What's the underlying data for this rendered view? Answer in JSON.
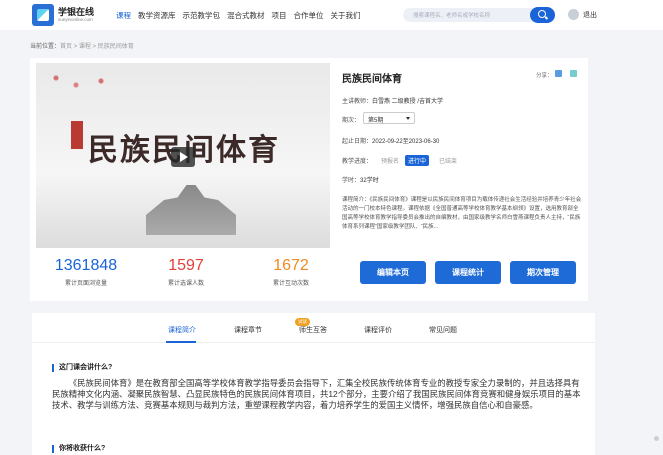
{
  "header": {
    "brand_name": "学银在线",
    "brand_sub": "xueyinonline.com",
    "nav": [
      "课程",
      "教学资源库",
      "示范教学包",
      "混合式教材",
      "项目",
      "合作单位",
      "关于我们"
    ],
    "search_placeholder": "搜索课程名、老师名或学校名称",
    "logout": "退出"
  },
  "breadcrumb": {
    "prefix": "当前位置：",
    "items": [
      "首页",
      "课程",
      "民族民间体育"
    ],
    "separator": " > "
  },
  "course": {
    "title": "民族民间体育",
    "cover_art_text": "民族民间体育",
    "share_label": "分享：",
    "teacher_label": "主讲教师：",
    "teacher_value": "白雪燕 二级教授 /吉首大学",
    "period_label": "期次：",
    "period_value": "第5期",
    "dates_label": "起止日期：",
    "dates_value": "2022-09-22至2023-06-30",
    "progress_label": "教学进度：",
    "progress_states": [
      "预报名",
      "进行中",
      "已结束"
    ],
    "progress_active_index": 1,
    "hours_label": "学时：",
    "hours_value": "32学时",
    "intro_label": "课程简介：",
    "intro_text": "《民族民间体育》课程是以民族民间体育项目为载体传递社会生活经验并培养青少年社会活动的一门校本特色课程。课程依据《全国普通高等学校体育教学基本纲领》设置，选用教育部全国高等学校体育教学指导委员会推出的自编教材，由国家级教学名师白雪燕课程负责人主持，“民族体育系列课程”国家级教学团队、“民族..."
  },
  "stats": [
    {
      "value": "1361848",
      "label": "累计页面浏览量",
      "color": "#1a64d8"
    },
    {
      "value": "1597",
      "label": "累计选课人数",
      "color": "#e0413a"
    },
    {
      "value": "1672",
      "label": "累计互动次数",
      "color": "#f08a24"
    }
  ],
  "actions": [
    "编辑本页",
    "课程统计",
    "期次管理"
  ],
  "tabs": {
    "items": [
      "课程简介",
      "课程章节",
      "师生互答",
      "课程评价",
      "常见问题"
    ],
    "active_index": 0,
    "badge": "试读"
  },
  "content": {
    "q1_title": "这门课会讲什么?",
    "q1_body": "《民族民间体育》是在教育部全国高等学校体育教学指导委员会指导下，汇集全校民族传统体育专业的教授专家全力录制的，并且选择具有民族精神文化内涵、凝聚民族智慧、凸显民族特色的民族民间体育项目，共12个部分，主要介绍了我国民族民间体育竞赛和健身娱乐项目的基本技术、教学与训练方法、竞赛基本规则与裁判方法，重塑课程教学内容，着力培养学生的爱国主义情怀，增强民族自信心和自豪感。",
    "q2_title": "你将收获什么?"
  },
  "colors": {
    "primary": "#1a64d8",
    "stat_blue": "#1a64d8",
    "stat_red": "#e0413a",
    "stat_orange": "#f08a24",
    "badge": "#f0a020"
  },
  "icons": [
    "search-icon",
    "user-icon",
    "share-icon",
    "play-icon"
  ]
}
